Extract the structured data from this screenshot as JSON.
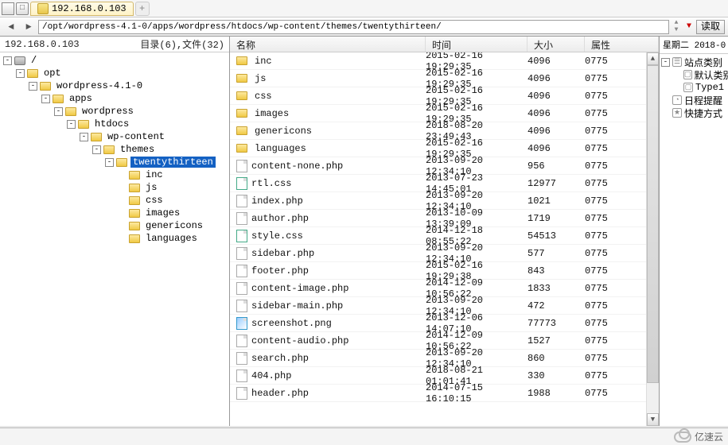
{
  "tabstrip": {
    "address_tab": "192.168.0.103",
    "plus": "+"
  },
  "toolbar": {
    "path": "/opt/wordpress-4.1-0/apps/wordpress/htdocs/wp-content/themes/twentythirteen/",
    "read_button": "读取"
  },
  "leftpane": {
    "header_host": "192.168.0.103",
    "header_counts": "目录(6),文件(32)"
  },
  "tree": [
    {
      "depth": 0,
      "toggle": "-",
      "icon": "root",
      "label": "/",
      "sel": false
    },
    {
      "depth": 1,
      "toggle": "-",
      "icon": "folder",
      "label": "opt",
      "sel": false
    },
    {
      "depth": 2,
      "toggle": "-",
      "icon": "folder",
      "label": "wordpress-4.1-0",
      "sel": false
    },
    {
      "depth": 3,
      "toggle": "-",
      "icon": "folder",
      "label": "apps",
      "sel": false
    },
    {
      "depth": 4,
      "toggle": "-",
      "icon": "folder",
      "label": "wordpress",
      "sel": false
    },
    {
      "depth": 5,
      "toggle": "-",
      "icon": "folder",
      "label": "htdocs",
      "sel": false
    },
    {
      "depth": 6,
      "toggle": "-",
      "icon": "folder",
      "label": "wp-content",
      "sel": false
    },
    {
      "depth": 7,
      "toggle": "-",
      "icon": "folder",
      "label": "themes",
      "sel": false
    },
    {
      "depth": 8,
      "toggle": "-",
      "icon": "folder",
      "label": "twentythirteen",
      "sel": true
    },
    {
      "depth": 9,
      "toggle": " ",
      "icon": "folder",
      "label": "inc",
      "sel": false
    },
    {
      "depth": 9,
      "toggle": " ",
      "icon": "folder",
      "label": "js",
      "sel": false
    },
    {
      "depth": 9,
      "toggle": " ",
      "icon": "folder",
      "label": "css",
      "sel": false
    },
    {
      "depth": 9,
      "toggle": " ",
      "icon": "folder",
      "label": "images",
      "sel": false
    },
    {
      "depth": 9,
      "toggle": " ",
      "icon": "folder",
      "label": "genericons",
      "sel": false
    },
    {
      "depth": 9,
      "toggle": " ",
      "icon": "folder",
      "label": "languages",
      "sel": false
    }
  ],
  "columns": {
    "name": "名称",
    "time": "时间",
    "size": "大小",
    "attr": "属性"
  },
  "files": [
    {
      "icon": "folder",
      "name": "inc",
      "time": "2015-02-16 19:29:35",
      "size": "4096",
      "attr": "0775"
    },
    {
      "icon": "folder",
      "name": "js",
      "time": "2015-02-16 19:29:35",
      "size": "4096",
      "attr": "0775"
    },
    {
      "icon": "folder",
      "name": "css",
      "time": "2015-02-16 19:29:35",
      "size": "4096",
      "attr": "0775"
    },
    {
      "icon": "folder",
      "name": "images",
      "time": "2015-02-16 19:29:35",
      "size": "4096",
      "attr": "0775"
    },
    {
      "icon": "folder",
      "name": "genericons",
      "time": "2018-08-20 23:49:43",
      "size": "4096",
      "attr": "0775"
    },
    {
      "icon": "folder",
      "name": "languages",
      "time": "2015-02-16 19:29:35",
      "size": "4096",
      "attr": "0775"
    },
    {
      "icon": "file",
      "name": "content-none.php",
      "time": "2013-09-20 12:34:10",
      "size": "956",
      "attr": "0775"
    },
    {
      "icon": "css",
      "name": "rtl.css",
      "time": "2013-07-23 14:45:01",
      "size": "12977",
      "attr": "0775"
    },
    {
      "icon": "file",
      "name": "index.php",
      "time": "2013-09-20 12:34:10",
      "size": "1021",
      "attr": "0775"
    },
    {
      "icon": "file",
      "name": "author.php",
      "time": "2013-10-09 13:39:09",
      "size": "1719",
      "attr": "0775"
    },
    {
      "icon": "css",
      "name": "style.css",
      "time": "2014-12-18 08:55:22",
      "size": "54513",
      "attr": "0775"
    },
    {
      "icon": "file",
      "name": "sidebar.php",
      "time": "2013-09-20 12:34:10",
      "size": "577",
      "attr": "0775"
    },
    {
      "icon": "file",
      "name": "footer.php",
      "time": "2015-02-16 19:29:38",
      "size": "843",
      "attr": "0775"
    },
    {
      "icon": "file",
      "name": "content-image.php",
      "time": "2014-12-09 10:56:22",
      "size": "1833",
      "attr": "0775"
    },
    {
      "icon": "file",
      "name": "sidebar-main.php",
      "time": "2013-09-20 12:34:10",
      "size": "472",
      "attr": "0775"
    },
    {
      "icon": "img",
      "name": "screenshot.png",
      "time": "2013-12-06 14:07:10",
      "size": "77773",
      "attr": "0775"
    },
    {
      "icon": "file",
      "name": "content-audio.php",
      "time": "2014-12-09 10:56:22",
      "size": "1527",
      "attr": "0775"
    },
    {
      "icon": "file",
      "name": "search.php",
      "time": "2013-09-20 12:34:10",
      "size": "860",
      "attr": "0775"
    },
    {
      "icon": "file",
      "name": "404.php",
      "time": "2018-08-21 01:01:41",
      "size": "330",
      "attr": "0775"
    },
    {
      "icon": "file",
      "name": "header.php",
      "time": "2014-07-15 16:10:15",
      "size": "1988",
      "attr": "0775"
    }
  ],
  "rightpane": {
    "header": "星期二 2018-0",
    "items": [
      {
        "icon": "tree",
        "label": "站点类别",
        "toggle": "-"
      },
      {
        "icon": "box",
        "label": "默认类别",
        "indent": 1
      },
      {
        "icon": "box",
        "label": "Type1",
        "indent": 1
      },
      {
        "icon": "bell",
        "label": "日程提醒",
        "indent": 0
      },
      {
        "icon": "star",
        "label": "快捷方式",
        "indent": 0
      }
    ]
  },
  "status": {
    "brand": "亿速云"
  }
}
